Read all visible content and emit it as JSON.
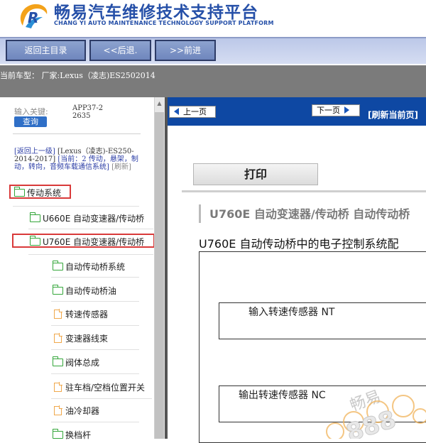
{
  "header": {
    "title": "畅易汽车维修技术支持平台",
    "subtitle": "CHANG YI AUTO MAINTENANCE TECHNOLOGY SUPPORT PLATFORM",
    "brand_color": "#2650a8"
  },
  "toolbar": {
    "home_label": "返回主目录",
    "back_label": "<<后退.",
    "forward_label": ">>前进"
  },
  "model_bar": {
    "text": "当前车型： 厂家:Lexus（凌志)ES2502014"
  },
  "search": {
    "keyword_label": "输入关键:",
    "value": "APP37-22635",
    "button_label": "查询"
  },
  "path": {
    "up_link": "[返回上一级]",
    "brand": "[Lexus（凌志)-ES250-2014-2017]",
    "current": "[当前：2 传动，悬架，制动，转向，音频车载通信系统]",
    "refresh": "[刷新]"
  },
  "tree": {
    "items": [
      {
        "label": "传动系统",
        "icon": "folder-icon",
        "highlighted": true
      },
      {
        "label": "U660E 自动变速器/传动桥",
        "icon": "folder-icon",
        "highlighted": false
      },
      {
        "label": "U760E 自动变速器/传动桥",
        "icon": "folder-icon",
        "highlighted": true
      },
      {
        "label": "自动传动桥系统",
        "icon": "folder-icon",
        "highlighted": false
      },
      {
        "label": "自动传动桥油",
        "icon": "folder-icon",
        "highlighted": false
      },
      {
        "label": "转速传感器",
        "icon": "document-icon",
        "highlighted": false
      },
      {
        "label": "变速器线束",
        "icon": "document-icon",
        "highlighted": false
      },
      {
        "label": "阀体总成",
        "icon": "folder-icon",
        "highlighted": false
      },
      {
        "label": "驻车档/空档位置开关",
        "icon": "document-icon",
        "highlighted": false
      },
      {
        "label": "油冷却器",
        "icon": "document-icon",
        "highlighted": false
      },
      {
        "label": "换档杆",
        "icon": "folder-icon",
        "highlighted": false
      }
    ]
  },
  "content": {
    "prev_label": "上一页",
    "next_label": "下一页",
    "refresh_label": "[刷新当前页]",
    "print_label": "打印",
    "section_title": "U760E 自动变速器/传动桥  自动传动桥",
    "doc_title": "U760E 自动传动桥中的电子控制系统配",
    "diagram": {
      "box1_label": "输入转速传感器 NT",
      "box2_label": "输出转速传感器 NC"
    },
    "watermark_text": "畅易",
    "watermark_number": "888"
  },
  "colors": {
    "nav_blue": "#0e48a3",
    "highlight_red": "#d93a3a",
    "folder_green": "#34a63a",
    "document_orange": "#f0a84b"
  }
}
